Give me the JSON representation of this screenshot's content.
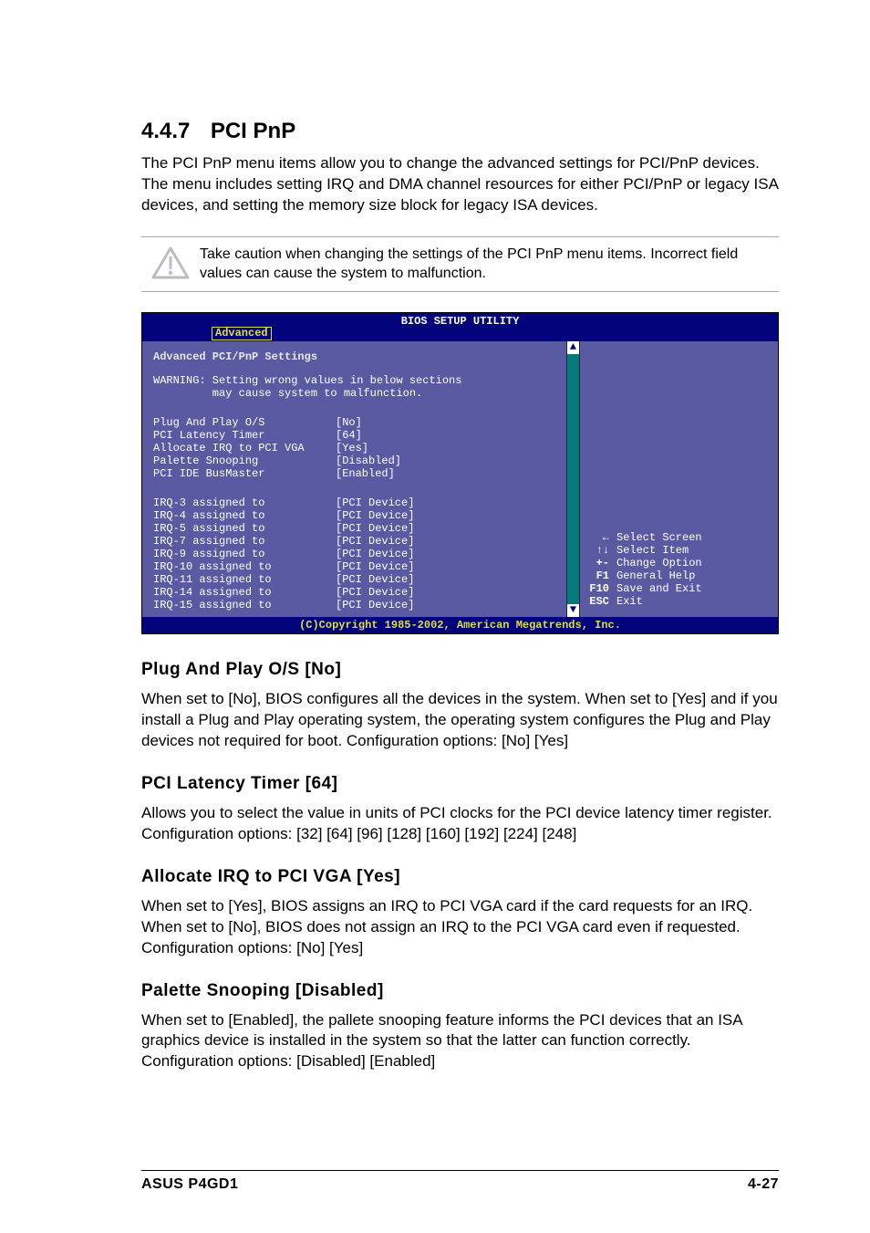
{
  "section": {
    "number": "4.4.7",
    "title": "PCI PnP",
    "intro": "The PCI PnP menu items allow you to change the advanced settings for PCI/PnP devices. The menu includes setting IRQ and DMA channel resources for either PCI/PnP or legacy ISA devices, and setting the memory size block for legacy ISA devices."
  },
  "caution": "Take caution when changing the settings of the PCI PnP menu items. Incorrect field values can cause the system to malfunction.",
  "bios": {
    "title": "BIOS SETUP UTILITY",
    "tab": "Advanced",
    "heading": "Advanced PCI/PnP Settings",
    "warning_l1": "WARNING: Setting wrong values in below sections",
    "warning_l2": "         may cause system to malfunction.",
    "settings1": [
      {
        "label": "Plug And Play O/S",
        "value": "[No]"
      },
      {
        "label": "PCI Latency Timer",
        "value": "[64]"
      },
      {
        "label": "Allocate IRQ to PCI VGA",
        "value": "[Yes]"
      },
      {
        "label": "Palette Snooping",
        "value": "[Disabled]"
      },
      {
        "label": "PCI IDE BusMaster",
        "value": "[Enabled]"
      }
    ],
    "settings2": [
      {
        "label": "IRQ-3 assigned to",
        "value": "[PCI Device]"
      },
      {
        "label": "IRQ-4 assigned to",
        "value": "[PCI Device]"
      },
      {
        "label": "IRQ-5 assigned to",
        "value": "[PCI Device]"
      },
      {
        "label": "IRQ-7 assigned to",
        "value": "[PCI Device]"
      },
      {
        "label": "IRQ-9 assigned to",
        "value": "[PCI Device]"
      },
      {
        "label": "IRQ-10 assigned to",
        "value": "[PCI Device]"
      },
      {
        "label": "IRQ-11 assigned to",
        "value": "[PCI Device]"
      },
      {
        "label": "IRQ-14 assigned to",
        "value": "[PCI Device]"
      },
      {
        "label": "IRQ-15 assigned to",
        "value": "[PCI Device]"
      }
    ],
    "help": [
      {
        "key": "←",
        "text": "Select Screen"
      },
      {
        "key": "↑↓",
        "text": "Select Item"
      },
      {
        "key": "+-",
        "text": "Change Option"
      },
      {
        "key": "F1",
        "text": "General Help"
      },
      {
        "key": "F10",
        "text": "Save and Exit"
      },
      {
        "key": "ESC",
        "text": "Exit"
      }
    ],
    "footer": "(C)Copyright 1985-2002, American Megatrends, Inc."
  },
  "subsections": [
    {
      "title": "Plug And Play O/S [No]",
      "body": "When set to [No], BIOS configures all the devices in the system. When set to [Yes] and if you install a Plug and Play operating system, the operating system configures the Plug and Play devices not required for boot. Configuration options: [No] [Yes]"
    },
    {
      "title": "PCI Latency Timer [64]",
      "body": "Allows you to select the value in units of PCI clocks for the PCI device latency timer register. Configuration options: [32] [64] [96] [128] [160] [192] [224] [248]"
    },
    {
      "title": "Allocate IRQ to PCI VGA [Yes]",
      "body": "When set to [Yes], BIOS assigns an IRQ to PCI VGA card if the card requests for an IRQ. When set to [No], BIOS does not assign an IRQ to the PCI VGA card even if requested. Configuration options: [No] [Yes]"
    },
    {
      "title": "Palette Snooping [Disabled]",
      "body": "When set to [Enabled], the pallete snooping feature informs the PCI devices that an ISA graphics device is installed in the system so that the latter can function correctly. Configuration options: [Disabled] [Enabled]"
    }
  ],
  "footer": {
    "left": "ASUS P4GD1",
    "right": "4-27"
  }
}
